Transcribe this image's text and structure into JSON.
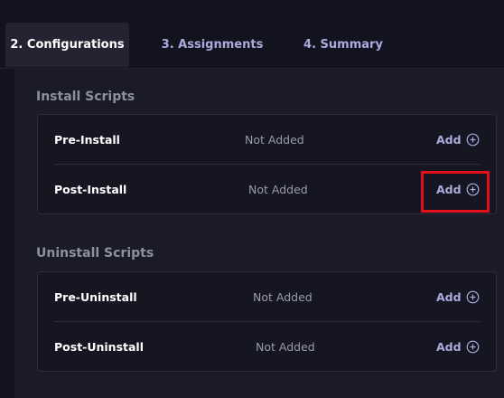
{
  "tabs": [
    {
      "label": "2. Configurations",
      "active": true
    },
    {
      "label": "3. Assignments",
      "active": false
    },
    {
      "label": "4. Summary",
      "active": false
    }
  ],
  "sections": [
    {
      "title": "Install Scripts",
      "rows": [
        {
          "label": "Pre-Install",
          "status": "Not Added",
          "action": "Add",
          "action_icon": "plus-circle-icon"
        },
        {
          "label": "Post-Install",
          "status": "Not Added",
          "action": "Add",
          "action_icon": "plus-circle-icon",
          "highlighted": true
        }
      ]
    },
    {
      "title": "Uninstall Scripts",
      "rows": [
        {
          "label": "Pre-Uninstall",
          "status": "Not Added",
          "action": "Add",
          "action_icon": "plus-circle-icon"
        },
        {
          "label": "Post-Uninstall",
          "status": "Not Added",
          "action": "Add",
          "action_icon": "plus-circle-icon"
        }
      ]
    }
  ],
  "colors": {
    "background": "#13131f",
    "panel": "#1a1a28",
    "active_tab": "#232331",
    "accent": "#a9acdc",
    "highlight": "#e4111b"
  }
}
